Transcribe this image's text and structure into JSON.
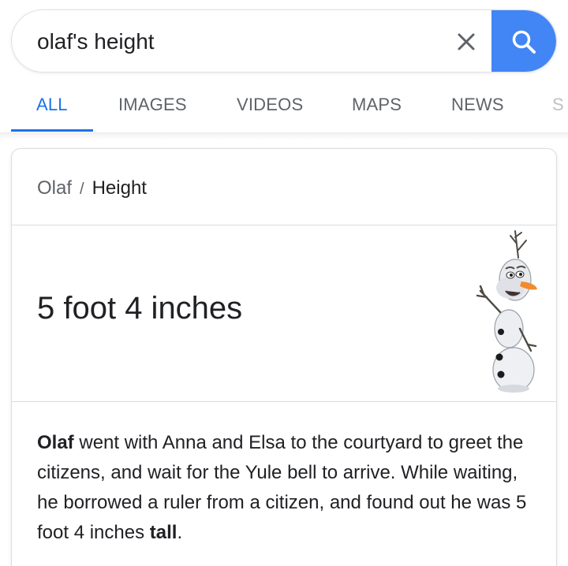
{
  "search": {
    "query": "olaf's height",
    "clear_icon": "close-icon",
    "search_icon": "search-icon",
    "accent_color": "#4285f4"
  },
  "tabs": [
    {
      "label": "ALL",
      "active": true
    },
    {
      "label": "IMAGES",
      "active": false
    },
    {
      "label": "VIDEOS",
      "active": false
    },
    {
      "label": "MAPS",
      "active": false
    },
    {
      "label": "NEWS",
      "active": false
    },
    {
      "label": "S",
      "active": false
    }
  ],
  "tab_active_color": "#1a73e8",
  "card": {
    "breadcrumb_parent": "Olaf",
    "breadcrumb_separator": "/",
    "breadcrumb_current": "Height",
    "answer": "5 foot 4 inches",
    "image": "olaf-snowman-image",
    "snippet": {
      "lead_bold": "Olaf",
      "body": " went with Anna and Elsa to the courtyard to greet the citizens, and wait for the Yule bell to arrive. While waiting, he borrowed a ruler from a citizen, and found out he was 5 foot 4 inches ",
      "tail_bold": "tall",
      "end": "."
    }
  }
}
